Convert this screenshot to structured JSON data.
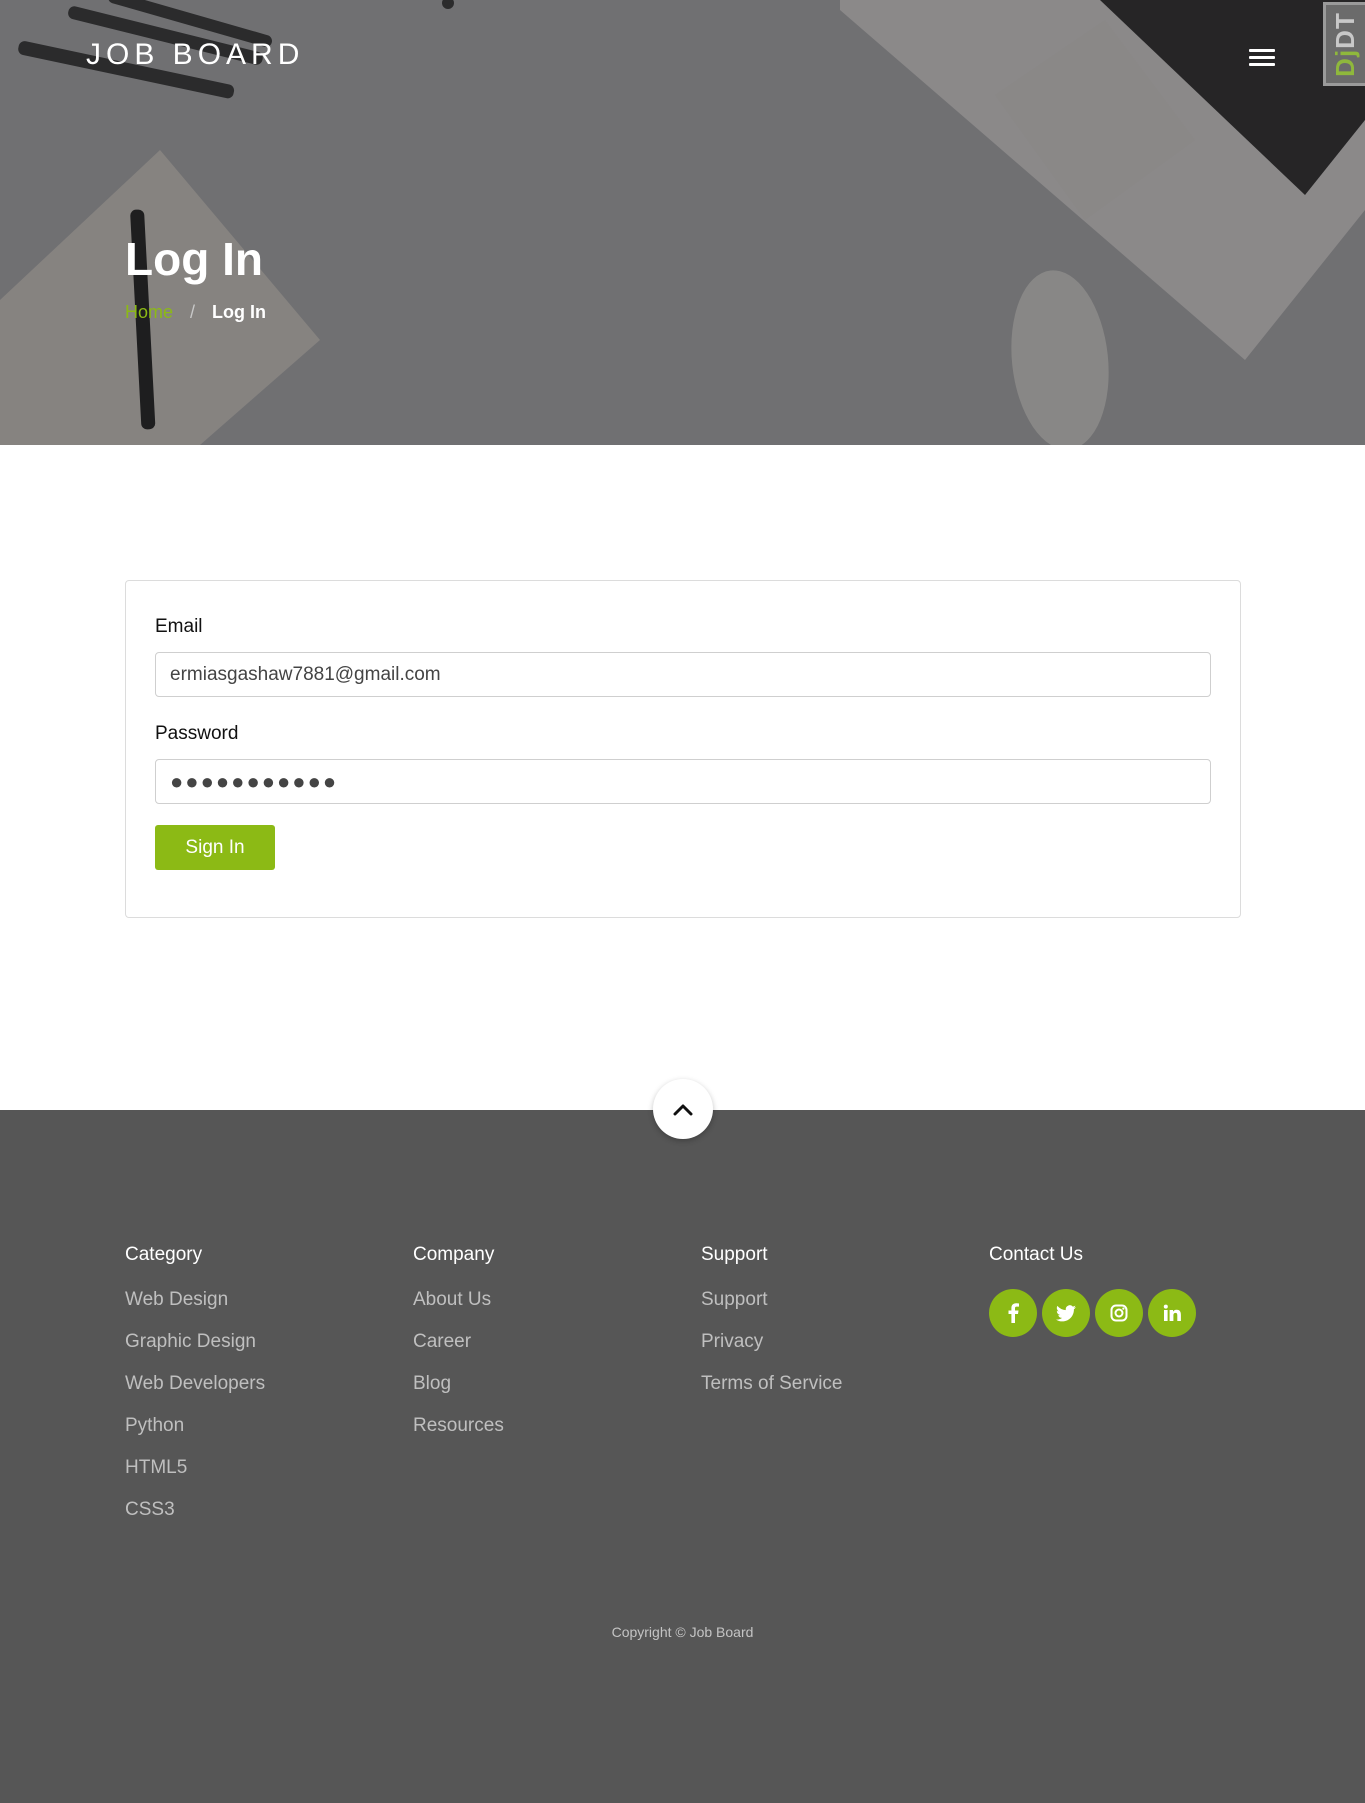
{
  "header": {
    "brand": "JOB BOARD",
    "debug_toolbar_label": "DjDT",
    "page_title": "Log In",
    "breadcrumb": {
      "home": "Home",
      "separator": "/",
      "current": "Log In"
    }
  },
  "form": {
    "email_label": "Email",
    "email_value": "ermiasgashaw7881@gmail.com",
    "password_label": "Password",
    "password_value": "●●●●●●●●●●●",
    "submit_label": "Sign In"
  },
  "footer": {
    "columns": [
      {
        "title": "Category",
        "links": [
          "Web Design",
          "Graphic Design",
          "Web Developers",
          "Python",
          "HTML5",
          "CSS3"
        ]
      },
      {
        "title": "Company",
        "links": [
          "About Us",
          "Career",
          "Blog",
          "Resources"
        ]
      },
      {
        "title": "Support",
        "links": [
          "Support",
          "Privacy",
          "Terms of Service"
        ]
      },
      {
        "title": "Contact Us",
        "socials": [
          "facebook-icon",
          "twitter-icon",
          "instagram-icon",
          "linkedin-icon"
        ]
      }
    ],
    "copyright": "Copyright © Job Board"
  },
  "colors": {
    "accent": "#8cba15",
    "hero_overlay": "#707072",
    "footer_bg": "#565656"
  }
}
